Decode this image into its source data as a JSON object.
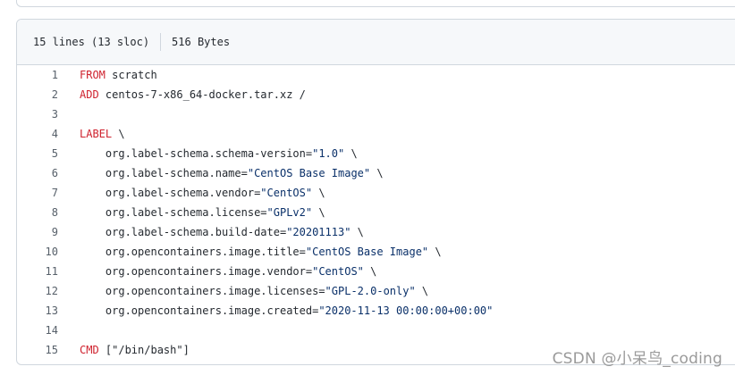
{
  "file": {
    "lines_info": "15 lines (13 sloc)",
    "size": "516 Bytes"
  },
  "code_lines": [
    {
      "n": "1",
      "parts": [
        {
          "t": "FROM",
          "c": "kw"
        },
        {
          "t": " scratch"
        }
      ]
    },
    {
      "n": "2",
      "parts": [
        {
          "t": "ADD",
          "c": "kw"
        },
        {
          "t": " centos-7-x86_64-docker.tar.xz /"
        }
      ]
    },
    {
      "n": "3",
      "parts": []
    },
    {
      "n": "4",
      "parts": [
        {
          "t": "LABEL",
          "c": "kw"
        },
        {
          "t": " \\"
        }
      ]
    },
    {
      "n": "5",
      "parts": [
        {
          "t": "    org.label-schema.schema-version="
        },
        {
          "t": "\"1.0\"",
          "c": "str"
        },
        {
          "t": " \\"
        }
      ]
    },
    {
      "n": "6",
      "parts": [
        {
          "t": "    org.label-schema.name="
        },
        {
          "t": "\"CentOS Base Image\"",
          "c": "str"
        },
        {
          "t": " \\"
        }
      ]
    },
    {
      "n": "7",
      "parts": [
        {
          "t": "    org.label-schema.vendor="
        },
        {
          "t": "\"CentOS\"",
          "c": "str"
        },
        {
          "t": " \\"
        }
      ]
    },
    {
      "n": "8",
      "parts": [
        {
          "t": "    org.label-schema.license="
        },
        {
          "t": "\"GPLv2\"",
          "c": "str"
        },
        {
          "t": " \\"
        }
      ]
    },
    {
      "n": "9",
      "parts": [
        {
          "t": "    org.label-schema.build-date="
        },
        {
          "t": "\"20201113\"",
          "c": "str"
        },
        {
          "t": " \\"
        }
      ]
    },
    {
      "n": "10",
      "parts": [
        {
          "t": "    org.opencontainers.image.title="
        },
        {
          "t": "\"CentOS Base Image\"",
          "c": "str"
        },
        {
          "t": " \\"
        }
      ]
    },
    {
      "n": "11",
      "parts": [
        {
          "t": "    org.opencontainers.image.vendor="
        },
        {
          "t": "\"CentOS\"",
          "c": "str"
        },
        {
          "t": " \\"
        }
      ]
    },
    {
      "n": "12",
      "parts": [
        {
          "t": "    org.opencontainers.image.licenses="
        },
        {
          "t": "\"GPL-2.0-only\"",
          "c": "str"
        },
        {
          "t": " \\"
        }
      ]
    },
    {
      "n": "13",
      "parts": [
        {
          "t": "    org.opencontainers.image.created="
        },
        {
          "t": "\"2020-11-13 00:00:00+00:00\"",
          "c": "str"
        }
      ]
    },
    {
      "n": "14",
      "parts": []
    },
    {
      "n": "15",
      "parts": [
        {
          "t": "CMD",
          "c": "kw"
        },
        {
          "t": " [\"/bin/bash\"]"
        }
      ]
    }
  ],
  "watermark": "CSDN @小呆鸟_coding",
  "colors": {
    "keyword": "#cf222e",
    "string": "#0a3069",
    "line_number": "#57606a",
    "border": "#d0d7de",
    "header_bg": "#f6f8fa"
  }
}
